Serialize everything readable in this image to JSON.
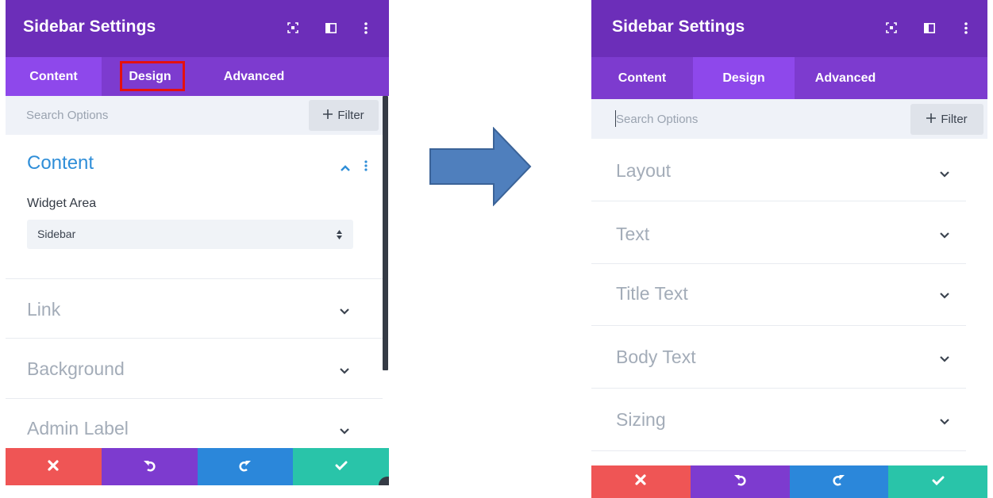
{
  "colors": {
    "header_bg": "#6c2eb9",
    "tabbar_bg": "#7d3bcf",
    "tab_active_bg": "#8e48eb",
    "highlight_outline": "#e5100e",
    "section_open_title": "#2f8ed8",
    "cancel": "#ef5555",
    "undo": "#7d3bcf",
    "redo": "#2b87da",
    "save": "#29c4a9",
    "arrow_fill": "#4f7fbd",
    "arrow_stroke": "#3b6398"
  },
  "left_panel": {
    "title": "Sidebar Settings",
    "header_icons": [
      "screen-icon",
      "split-view-icon",
      "more-vertical-icon"
    ],
    "tabs": [
      {
        "label": "Content",
        "active": true
      },
      {
        "label": "Design",
        "active": false,
        "highlighted": true
      },
      {
        "label": "Advanced",
        "active": false
      }
    ],
    "search": {
      "placeholder": "Search Options",
      "filter_label": "Filter"
    },
    "open_section": {
      "title": "Content",
      "field_label": "Widget Area",
      "select_value": "Sidebar"
    },
    "sections": [
      {
        "title": "Link"
      },
      {
        "title": "Background"
      },
      {
        "title": "Admin Label"
      }
    ],
    "action_buttons": [
      "cancel-icon",
      "undo-icon",
      "redo-icon",
      "save-icon"
    ]
  },
  "arrow_icon": "right-arrow-icon",
  "right_panel": {
    "title": "Sidebar Settings",
    "header_icons": [
      "screen-icon",
      "split-view-icon",
      "more-vertical-icon"
    ],
    "tabs": [
      {
        "label": "Content",
        "active": false
      },
      {
        "label": "Design",
        "active": true
      },
      {
        "label": "Advanced",
        "active": false
      }
    ],
    "search": {
      "placeholder": "Search Options",
      "filter_label": "Filter"
    },
    "sections": [
      {
        "title": "Layout"
      },
      {
        "title": "Text"
      },
      {
        "title": "Title Text"
      },
      {
        "title": "Body Text"
      },
      {
        "title": "Sizing"
      }
    ],
    "action_buttons": [
      "cancel-icon",
      "undo-icon",
      "redo-icon",
      "save-icon"
    ]
  }
}
